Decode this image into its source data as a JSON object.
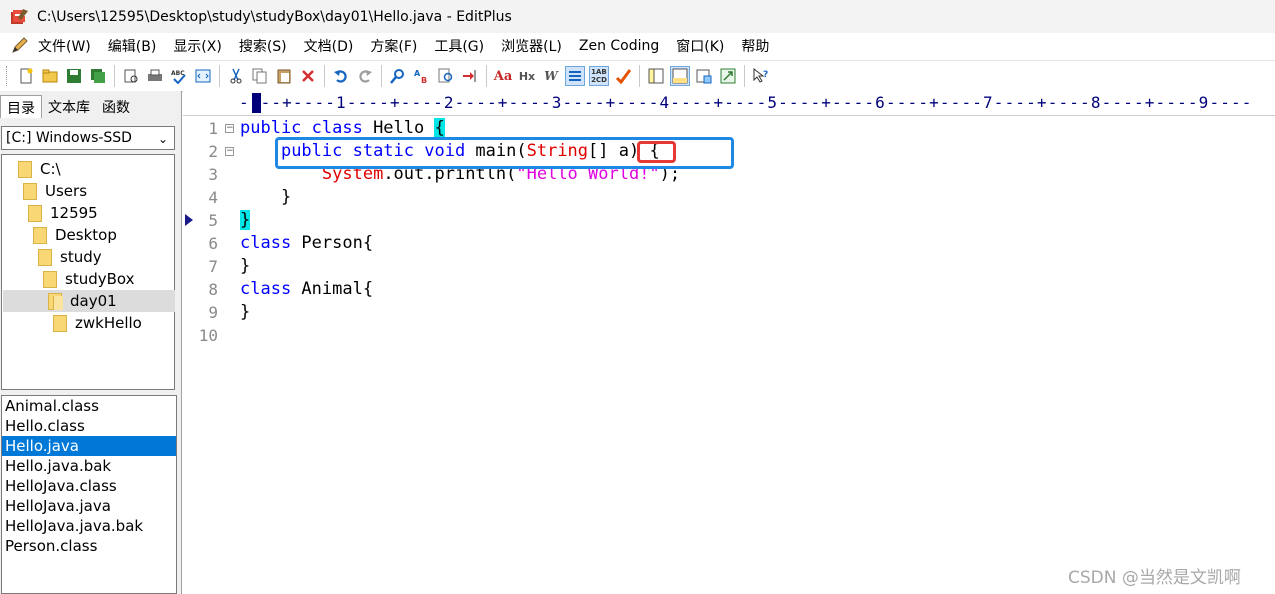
{
  "window": {
    "title": "C:\\Users\\12595\\Desktop\\study\\studyBox\\day01\\Hello.java - EditPlus"
  },
  "menu": [
    "文件(W)",
    "编辑(B)",
    "显示(X)",
    "搜索(S)",
    "文档(D)",
    "方案(F)",
    "工具(G)",
    "浏览器(L)",
    "Zen Coding",
    "窗口(K)",
    "帮助"
  ],
  "toolbar": {
    "icons": [
      "new-file-icon",
      "open-file-icon",
      "save-icon",
      "save-all-icon",
      "print-preview-icon",
      "print-icon",
      "spellcheck-icon",
      "browser-preview-icon",
      "cut-icon",
      "copy-icon",
      "paste-icon",
      "delete-icon",
      "undo-icon",
      "redo-icon",
      "find-icon",
      "replace-icon",
      "find-in-files-icon",
      "goto-line-icon",
      "font-icon",
      "hex-view-icon",
      "word-wrap-icon",
      "line-number-icon",
      "column-marker-icon",
      "tools-icon",
      "directory-window-icon",
      "output-window-icon",
      "clip-window-icon",
      "fullscreen-icon",
      "help-context-icon"
    ],
    "labels": {
      "font": "Aa",
      "hex": "Hx",
      "wrap": "W",
      "column": "1AB\n2CD"
    }
  },
  "sidebar": {
    "tabs": [
      "目录",
      "文本库",
      "函数"
    ],
    "drive": "[C:] Windows-SSD",
    "tree": [
      "C:\\",
      "Users",
      "12595",
      "Desktop",
      "study",
      "studyBox",
      "day01",
      "zwkHello"
    ],
    "selected_folder": "day01",
    "files": [
      "Animal.class",
      "Hello.class",
      "Hello.java",
      "Hello.java.bak",
      "HelloJava.class",
      "HelloJava.java",
      "HelloJava.java.bak",
      "Person.class"
    ],
    "selected_file": "Hello.java"
  },
  "ruler": {
    "text": "----+----1----+----2----+----3----+----4----+----5----+----6----+----7----+----8----+----9----"
  },
  "editor": {
    "line_numbers": [
      "1",
      "2",
      "3",
      "4",
      "5",
      "6",
      "7",
      "8",
      "9",
      "10"
    ],
    "code": {
      "l1_kw": "public class",
      "l1_name": " Hello ",
      "l1_brace": "{",
      "l2_indent": "    ",
      "l2_kw": "public static void",
      "l2_name": " main(",
      "l2_type": "String",
      "l2_rest": "[] a) {",
      "l3_indent": "        ",
      "l3_cls": "System",
      "l3_mid": ".out.println(",
      "l3_str": "\"Hello World!\"",
      "l3_end": ");",
      "l4": "    }",
      "l5_brace": "}",
      "l6_kw": "class",
      "l6_rest": " Person{",
      "l7": "}",
      "l8_kw": "class",
      "l8_rest": " Animal{",
      "l9": "}"
    }
  },
  "watermark": "CSDN @当然是文凯啊",
  "colors": {
    "keyword": "#0000ff",
    "class": "#e00000",
    "string": "#e000e0",
    "brace_highlight": "#00e6e6",
    "selection": "#0078d7",
    "annotation_blue": "#1e88e5",
    "annotation_red": "#e53935"
  }
}
